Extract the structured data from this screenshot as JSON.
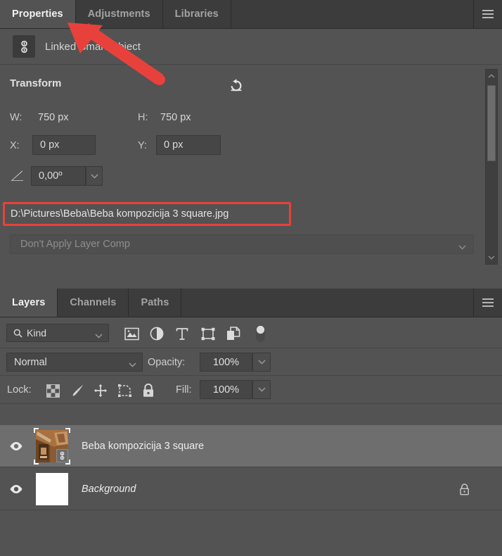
{
  "properties_panel": {
    "tabs": [
      {
        "label": "Properties",
        "active": true
      },
      {
        "label": "Adjustments",
        "active": false
      },
      {
        "label": "Libraries",
        "active": false
      }
    ],
    "menu_icon": "hamburger-menu-icon",
    "object_type": {
      "badge_icon": "linked-smart-object-icon",
      "label": "Linked Smart Object"
    },
    "transform": {
      "title": "Transform",
      "revert_icon": "revert-reset-icon",
      "width_label": "W:",
      "width_value": "750 px",
      "height_label": "H:",
      "height_value": "750 px",
      "x_label": "X:",
      "x_value": "0 px",
      "y_label": "Y:",
      "y_value": "0 px",
      "angle_icon": "angle-rotation-icon",
      "angle_value": "0,00º"
    },
    "linked_file_path": "D:\\Pictures\\Beba\\Beba kompozicija 3 square.jpg",
    "layer_comp": {
      "selected": "Don't Apply Layer Comp",
      "chevron_icon": "chevron-down-icon"
    },
    "scrollbar": {
      "up_icon": "chevron-up-icon",
      "down_icon": "chevron-down-icon"
    }
  },
  "layers_panel": {
    "tabs": [
      {
        "label": "Layers",
        "active": true
      },
      {
        "label": "Channels",
        "active": false
      },
      {
        "label": "Paths",
        "active": false
      }
    ],
    "menu_icon": "hamburger-menu-icon",
    "filter": {
      "search_icon": "search-icon",
      "kind_label": "Kind",
      "chevron_icon": "chevron-down-icon",
      "type_filters": [
        "pixel-layer-filter-icon",
        "adjustment-layer-filter-icon",
        "type-layer-filter-icon",
        "shape-layer-filter-icon",
        "smart-object-filter-icon",
        "filter-toggle-switch-icon"
      ]
    },
    "blend": {
      "mode": "Normal",
      "chevron_icon": "chevron-down-icon",
      "opacity_label": "Opacity:",
      "opacity_value": "100%",
      "opacity_chevron_icon": "chevron-down-icon"
    },
    "lock": {
      "label": "Lock:",
      "icons": [
        "lock-transparent-pixels-icon",
        "lock-image-pixels-icon",
        "lock-position-icon",
        "lock-artboard-nesting-icon",
        "lock-all-icon"
      ],
      "fill_label": "Fill:",
      "fill_value": "100%",
      "fill_chevron_icon": "chevron-down-icon"
    },
    "layers": [
      {
        "name": "Beba kompozicija 3 square",
        "selected": true,
        "italic": false,
        "visibility_icon": "eye-visible-icon",
        "thumbnail": "photo-thumbnail-sepia",
        "linked_badge_icon": "linked-smart-object-icon",
        "locked": false
      },
      {
        "name": "Background",
        "selected": false,
        "italic": true,
        "visibility_icon": "eye-visible-icon",
        "thumbnail": "white-thumbnail",
        "linked_badge_icon": null,
        "locked": true,
        "lock_icon": "lock-icon"
      }
    ]
  },
  "annotations": {
    "arrow": {
      "name": "red-pointer-arrow",
      "color": "#e8413c",
      "points_to": "Properties"
    },
    "highlight_box": {
      "name": "red-highlight-box",
      "color": "#e8413c",
      "around": "linked_file_path"
    }
  }
}
